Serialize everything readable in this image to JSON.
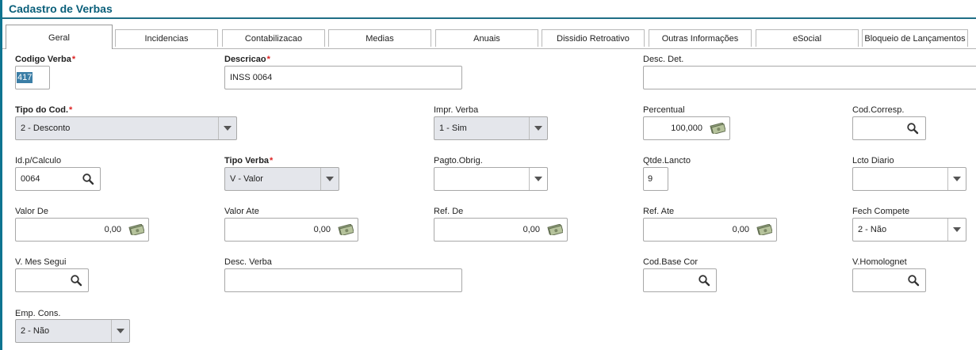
{
  "page": {
    "title": "Cadastro de Verbas"
  },
  "tabs": [
    {
      "label": "Geral",
      "active": true
    },
    {
      "label": "Incidencias"
    },
    {
      "label": "Contabilizacao"
    },
    {
      "label": "Medias"
    },
    {
      "label": "Anuais"
    },
    {
      "label": "Dissidio Retroativo"
    },
    {
      "label": "Outras Informações"
    },
    {
      "label": "eSocial"
    },
    {
      "label": "Bloqueio de Lançamentos"
    }
  ],
  "fields": {
    "codigo_verba": {
      "label": "Codigo Verba",
      "required": "*",
      "value": "417"
    },
    "descricao": {
      "label": "Descricao",
      "required": "*",
      "value": "INSS 0064"
    },
    "desc_det": {
      "label": "Desc. Det.",
      "value": ""
    },
    "tipo_cod": {
      "label": "Tipo do Cod.",
      "required": "*",
      "value": "2 - Desconto"
    },
    "impr_verba": {
      "label": "Impr. Verba",
      "value": "1 - Sim"
    },
    "percentual": {
      "label": "Percentual",
      "value": "100,000"
    },
    "cod_corresp": {
      "label": "Cod.Corresp.",
      "value": ""
    },
    "id_calculo": {
      "label": "Id.p/Calculo",
      "value": "0064"
    },
    "tipo_verba": {
      "label": "Tipo Verba",
      "required": "*",
      "value": "V - Valor"
    },
    "pagto_obrig": {
      "label": "Pagto.Obrig.",
      "value": ""
    },
    "qtde_lancto": {
      "label": "Qtde.Lancto",
      "value": "9"
    },
    "lcto_diario": {
      "label": "Lcto Diario",
      "value": ""
    },
    "valor_de": {
      "label": "Valor De",
      "value": "0,00"
    },
    "valor_ate": {
      "label": "Valor Ate",
      "value": "0,00"
    },
    "ref_de": {
      "label": "Ref. De",
      "value": "0,00"
    },
    "ref_ate": {
      "label": "Ref. Ate",
      "value": "0,00"
    },
    "fech_compete": {
      "label": "Fech Compete",
      "value": "2 - Não"
    },
    "v_mes_segui": {
      "label": "V. Mes Segui",
      "value": ""
    },
    "desc_verba": {
      "label": "Desc. Verba",
      "value": ""
    },
    "cod_base_cor": {
      "label": "Cod.Base Cor",
      "value": ""
    },
    "v_homolognet": {
      "label": "V.Homolognet",
      "value": ""
    },
    "emp_cons": {
      "label": "Emp. Cons.",
      "value": "2 - Não"
    }
  },
  "icons": {
    "search": "search-icon",
    "money": "money-icon",
    "dropdown": "chevron-down-icon"
  },
  "colors": {
    "accent": "#0a5f7a",
    "required": "#dd2222",
    "select_gray": "#e4e6eb"
  }
}
